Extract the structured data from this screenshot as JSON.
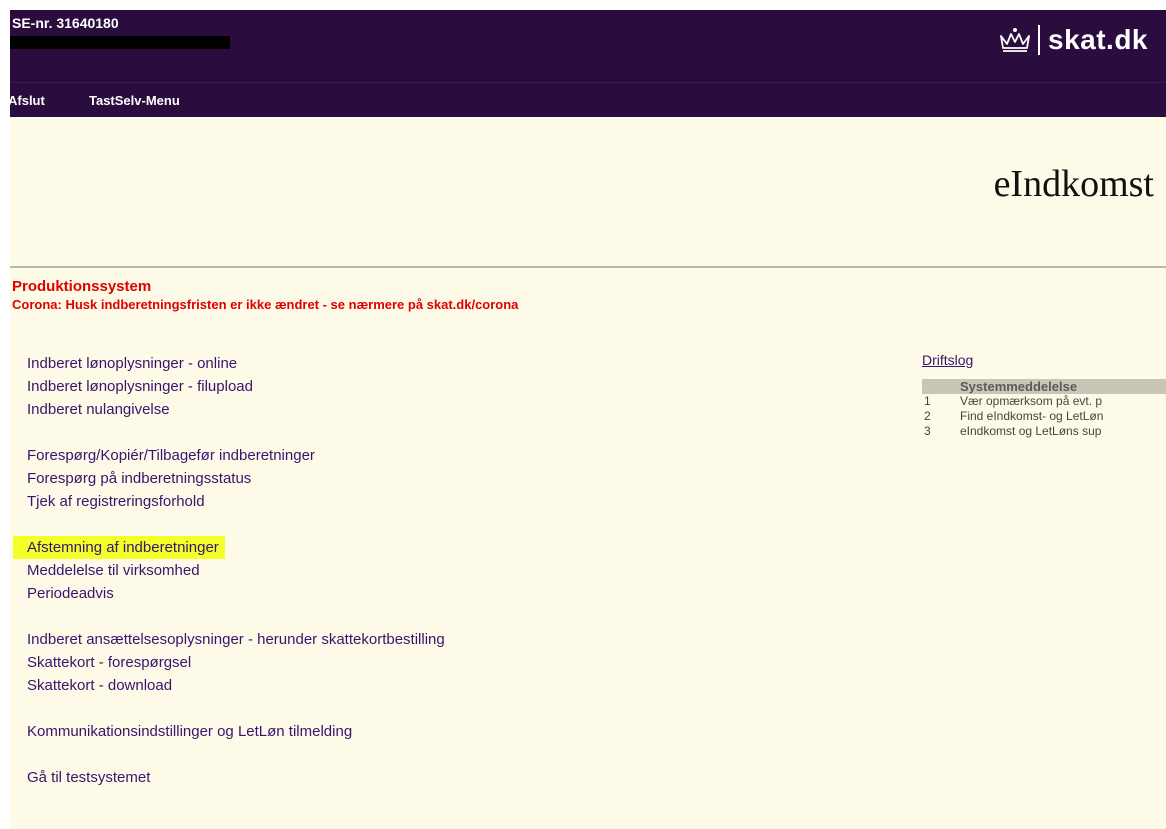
{
  "header": {
    "se_nr": "SE-nr. 31640180",
    "logo_text": "skat.dk",
    "logo_icon": "crown-icon"
  },
  "nav": {
    "items": [
      {
        "label": "Afslut"
      },
      {
        "label": "TastSelv-Menu"
      }
    ]
  },
  "page_title": "eIndkomst",
  "production": {
    "title": "Produktionssystem",
    "notice": "Corona: Husk indberetningsfristen er ikke ændret - se nærmere på skat.dk/corona"
  },
  "menu": {
    "groups": [
      {
        "links": [
          {
            "label": "Indberet lønoplysninger - online"
          },
          {
            "label": "Indberet lønoplysninger - filupload"
          },
          {
            "label": "Indberet nulangivelse"
          }
        ]
      },
      {
        "links": [
          {
            "label": "Forespørg/Kopiér/Tilbagefør indberetninger"
          },
          {
            "label": "Forespørg på indberetningsstatus"
          },
          {
            "label": "Tjek af registreringsforhold"
          }
        ]
      },
      {
        "links": [
          {
            "label": "Afstemning af indberetninger"
          },
          {
            "label": "Meddelelse til virksomhed"
          },
          {
            "label": "Periodeadvis"
          }
        ]
      },
      {
        "links": [
          {
            "label": "Indberet ansættelsesoplysninger - herunder skattekortbestilling"
          },
          {
            "label": "Skattekort - forespørgsel"
          },
          {
            "label": "Skattekort - download"
          }
        ]
      },
      {
        "links": [
          {
            "label": "Kommunikationsindstillinger og LetLøn tilmelding"
          }
        ]
      },
      {
        "links": [
          {
            "label": "Gå til testsystemet"
          }
        ]
      }
    ]
  },
  "sidebar": {
    "driftslog": "Driftslog",
    "system_header": "Systemmeddelelse",
    "messages": [
      {
        "num": "1",
        "text": "Vær opmærksom på evt. p"
      },
      {
        "num": "2",
        "text": "Find eIndkomst- og LetLøn"
      },
      {
        "num": "3",
        "text": "eIndkomst og LetLøns sup"
      }
    ]
  },
  "colors": {
    "header_bg": "#2a0d3e",
    "page_bg": "#fdfbe7",
    "link": "#3a1370",
    "alert": "#e00000",
    "highlight": "#f4ff2a"
  }
}
